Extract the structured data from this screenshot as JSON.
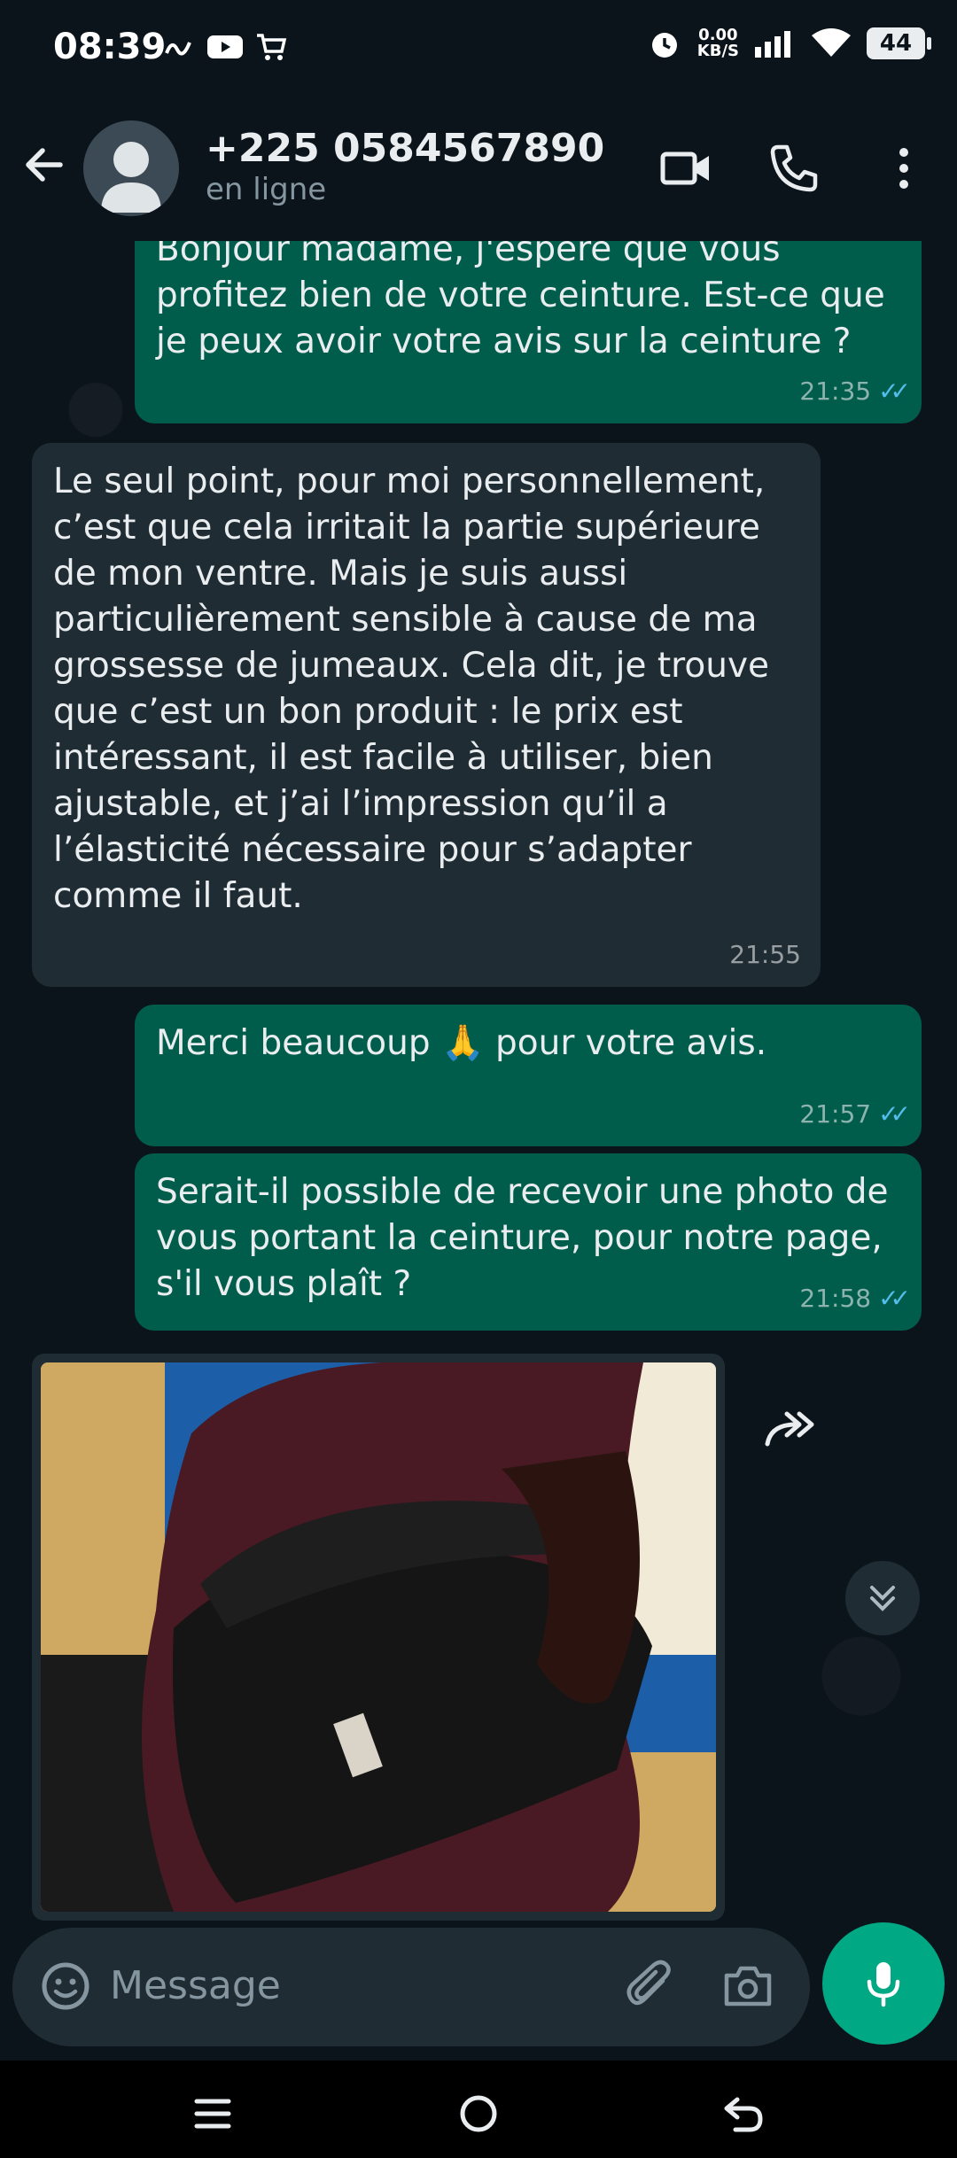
{
  "status_bar": {
    "time": "08:39",
    "net_speed_top": "0.00",
    "net_speed_bottom": "KB/S",
    "battery": "44"
  },
  "header": {
    "contact": "+225 0584567890",
    "status": "en ligne"
  },
  "messages": [
    {
      "direction": "out",
      "text": "Bonjour madame, j'espère que vous profitez bien de votre ceinture. Est-ce que je peux avoir votre avis sur la ceinture ?",
      "time": "21:35"
    },
    {
      "direction": "in",
      "text": "Le seul point, pour moi personnellement, c’est que cela irritait la partie supérieure de mon ventre. Mais je suis aussi particulièrement sensible à cause de ma grossesse de jumeaux. Cela dit, je trouve que c’est un bon produit : le prix est intéressant, il est facile à utiliser, bien ajustable, et j’ai l’impression qu’il a l’élasticité nécessaire pour s’adapter comme il faut.",
      "time": "21:55"
    },
    {
      "direction": "out",
      "text": "Merci beaucoup 🙏 pour votre avis.",
      "time": "21:57"
    },
    {
      "direction": "out",
      "text": "Serait-il possible de recevoir une photo de vous portant la ceinture, pour notre page, s'il vous plaît ?",
      "time": "21:58"
    }
  ],
  "composer": {
    "placeholder": "Message"
  },
  "icons": {
    "back": "arrow-left-icon",
    "video": "video-call-icon",
    "call": "phone-icon",
    "menu": "more-vertical-icon",
    "emoji": "emoji-icon",
    "attach": "paperclip-icon",
    "camera": "camera-icon",
    "mic": "mic-icon",
    "forward": "forward-icon",
    "scroll": "double-chevron-down-icon"
  },
  "colors": {
    "accent": "#00a884",
    "outgoing_bubble": "#005c4b",
    "incoming_bubble": "#202c33",
    "read_ticks": "#53bdeb",
    "background": "#0b141a"
  }
}
